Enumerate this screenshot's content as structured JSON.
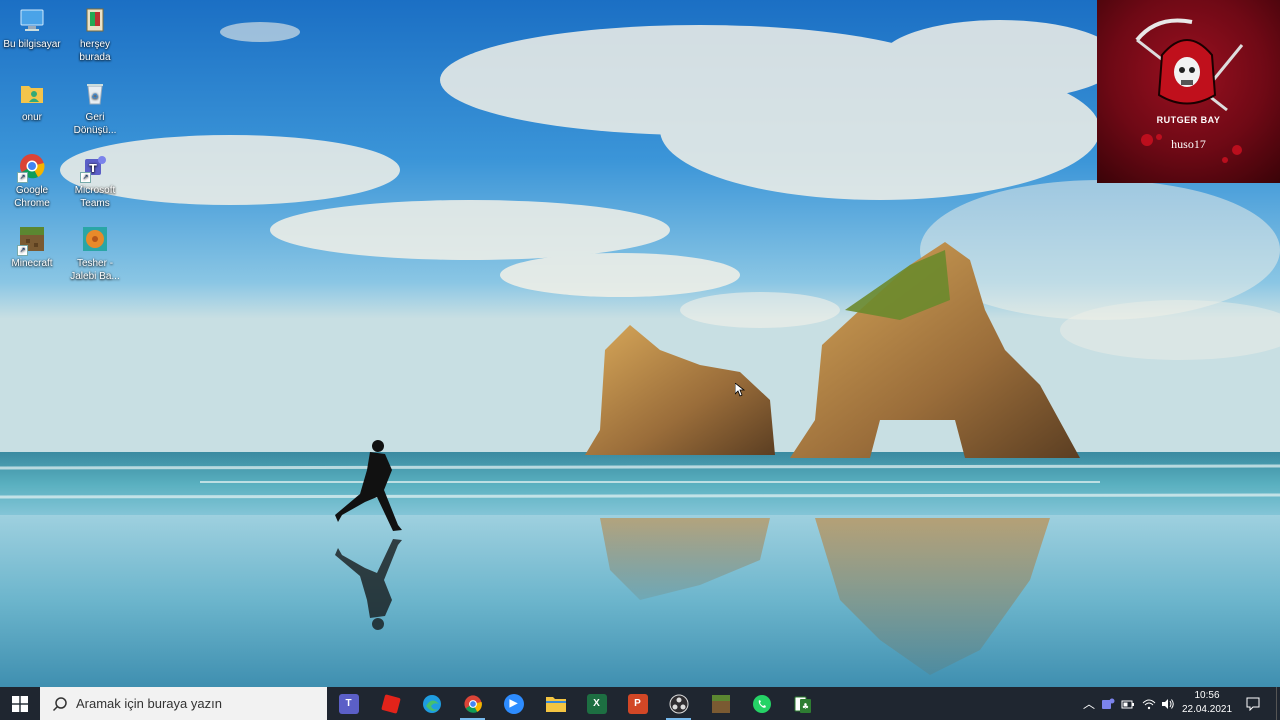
{
  "desktop": {
    "icons": [
      {
        "label": "Bu bilgisayar",
        "icon": "computer-icon"
      },
      {
        "label": "herşey burada",
        "icon": "folder-icon"
      },
      {
        "label": "onur",
        "icon": "user-folder-icon"
      },
      {
        "label": "Geri Dönüşü...",
        "icon": "recycle-bin-icon"
      },
      {
        "label": "Google Chrome",
        "icon": "chrome-icon"
      },
      {
        "label": "Microsoft Teams",
        "icon": "teams-icon"
      },
      {
        "label": "Minecraft",
        "icon": "minecraft-icon"
      },
      {
        "label": "Tesher - Jalebi Ba...",
        "icon": "music-icon"
      }
    ]
  },
  "overlay": {
    "brand": "RUTGER BAY",
    "user": "huso17"
  },
  "taskbar": {
    "search_placeholder": "Aramak için buraya yazın",
    "apps": [
      {
        "name": "teams",
        "color": "#5b5fc7"
      },
      {
        "name": "roblox",
        "color": "#e2231a"
      },
      {
        "name": "edge",
        "color": "#1f9de0"
      },
      {
        "name": "chrome",
        "color": "#34a853"
      },
      {
        "name": "zoom",
        "color": "#2d8cff"
      },
      {
        "name": "file-explorer",
        "color": "#f4c542"
      },
      {
        "name": "excel",
        "color": "#1d6f42"
      },
      {
        "name": "powerpoint",
        "color": "#d24726"
      },
      {
        "name": "obs",
        "color": "#302e31"
      },
      {
        "name": "minecraft",
        "color": "#5b8731"
      },
      {
        "name": "whatsapp",
        "color": "#25d366"
      },
      {
        "name": "solitaire",
        "color": "#2e7d32"
      }
    ],
    "clock": {
      "time": "10:56",
      "date": "22.04.2021"
    }
  }
}
